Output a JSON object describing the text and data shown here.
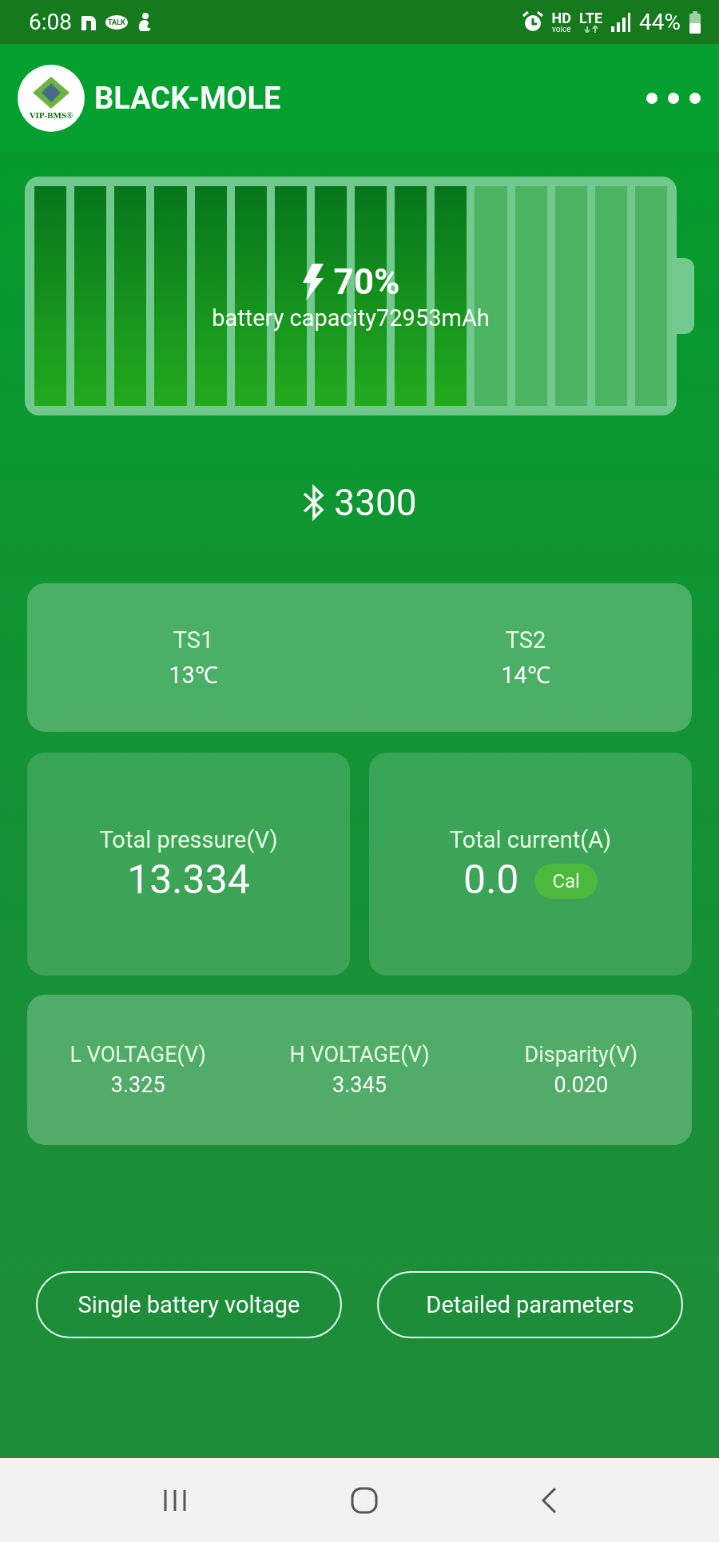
{
  "status_bar": {
    "time": "6:08",
    "talk_badge": "TALK",
    "hd": "HD",
    "voice": "voice",
    "network": "LTE",
    "battery": "44%"
  },
  "app_bar": {
    "logo_text": "VIP-BMS®",
    "title": "BLACK-MOLE"
  },
  "battery": {
    "level": 0.7,
    "percent": "70%",
    "capacity": "battery capacity72953mAh",
    "charging": true
  },
  "bluetooth": {
    "value": "3300"
  },
  "temperatures": [
    {
      "label": "TS1",
      "value": "13℃"
    },
    {
      "label": "TS2",
      "value": "14℃"
    }
  ],
  "totals": [
    {
      "label": "Total pressure(V)",
      "value": "13.334"
    },
    {
      "label": "Total current(A)",
      "value": "0.0",
      "button": "Cal"
    }
  ],
  "voltages": [
    {
      "label": "L VOLTAGE(V)",
      "value": "3.325"
    },
    {
      "label": "H VOLTAGE(V)",
      "value": "3.345"
    },
    {
      "label": "Disparity(V)",
      "value": "0.020"
    }
  ],
  "buttons": [
    "Single battery voltage",
    "Detailed parameters"
  ]
}
